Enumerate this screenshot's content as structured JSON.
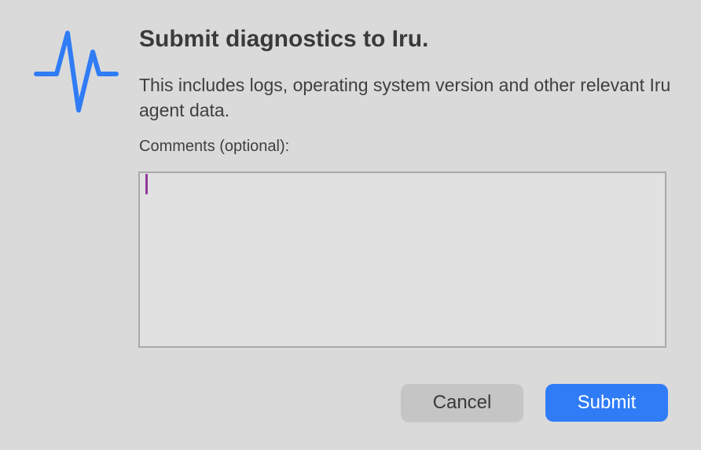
{
  "dialog": {
    "title": "Submit diagnostics to Iru.",
    "description": "This includes logs, operating system version and other relevant Iru agent data.",
    "icon": "activity-pulse-icon",
    "accent_color": "#2f7cf6"
  },
  "comments": {
    "label": "Comments (optional):",
    "value": "",
    "caret_color": "#8e3b9a"
  },
  "buttons": {
    "cancel_label": "Cancel",
    "submit_label": "Submit"
  }
}
